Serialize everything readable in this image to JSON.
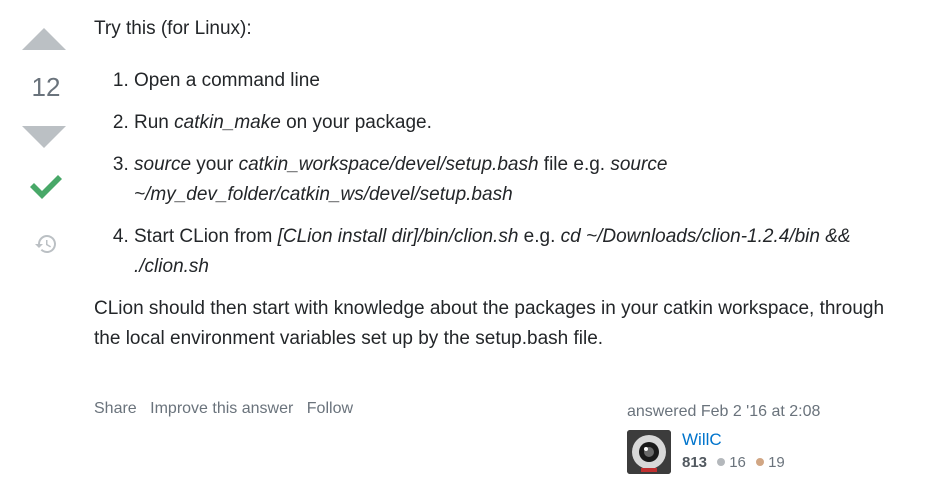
{
  "vote": {
    "score": "12"
  },
  "answer": {
    "intro": "Try this (for Linux):",
    "steps": [
      {
        "num": "1.",
        "parts": [
          {
            "t": "Open a command line"
          }
        ]
      },
      {
        "num": "2.",
        "parts": [
          {
            "t": "Run "
          },
          {
            "t": "catkin_make"
          },
          {
            "t": " on your package."
          }
        ]
      },
      {
        "num": "3.",
        "parts": [
          {
            "t": "source"
          },
          {
            "t": " your "
          },
          {
            "t": "catkin_workspace/devel/setup.bash"
          },
          {
            "t": " file e.g. "
          },
          {
            "t": "source ~/my_dev_folder/catkin_ws/devel/setup.bash"
          }
        ]
      },
      {
        "num": "4.",
        "parts": [
          {
            "t": "Start CLion from "
          },
          {
            "t": "[CLion install dir]/bin/clion.sh"
          },
          {
            "t": " e.g. "
          },
          {
            "t": "cd ~/Downloads/clion-1.2.4/bin && ./clion.sh"
          }
        ]
      }
    ],
    "summary": "CLion should then start with knowledge about the packages in your catkin workspace, through the local environment variables set up by the setup.bash file."
  },
  "menu": {
    "share": "Share",
    "improve": "Improve this answer",
    "follow": "Follow"
  },
  "signature": {
    "answered": "answered Feb 2 '16 at 2:08",
    "user_name": "WillC",
    "reputation": "813",
    "silver_count": "16",
    "bronze_count": "19"
  },
  "colors": {
    "accepted": "#48a868",
    "vote_arrow": "#bbc0c4",
    "link": "#0074cc",
    "silver": "#b4b8bc",
    "bronze": "#d1a684"
  },
  "icons": {
    "upvote": "upvote-arrow-icon",
    "downvote": "downvote-arrow-icon",
    "accepted": "checkmark-icon",
    "history": "history-icon"
  }
}
